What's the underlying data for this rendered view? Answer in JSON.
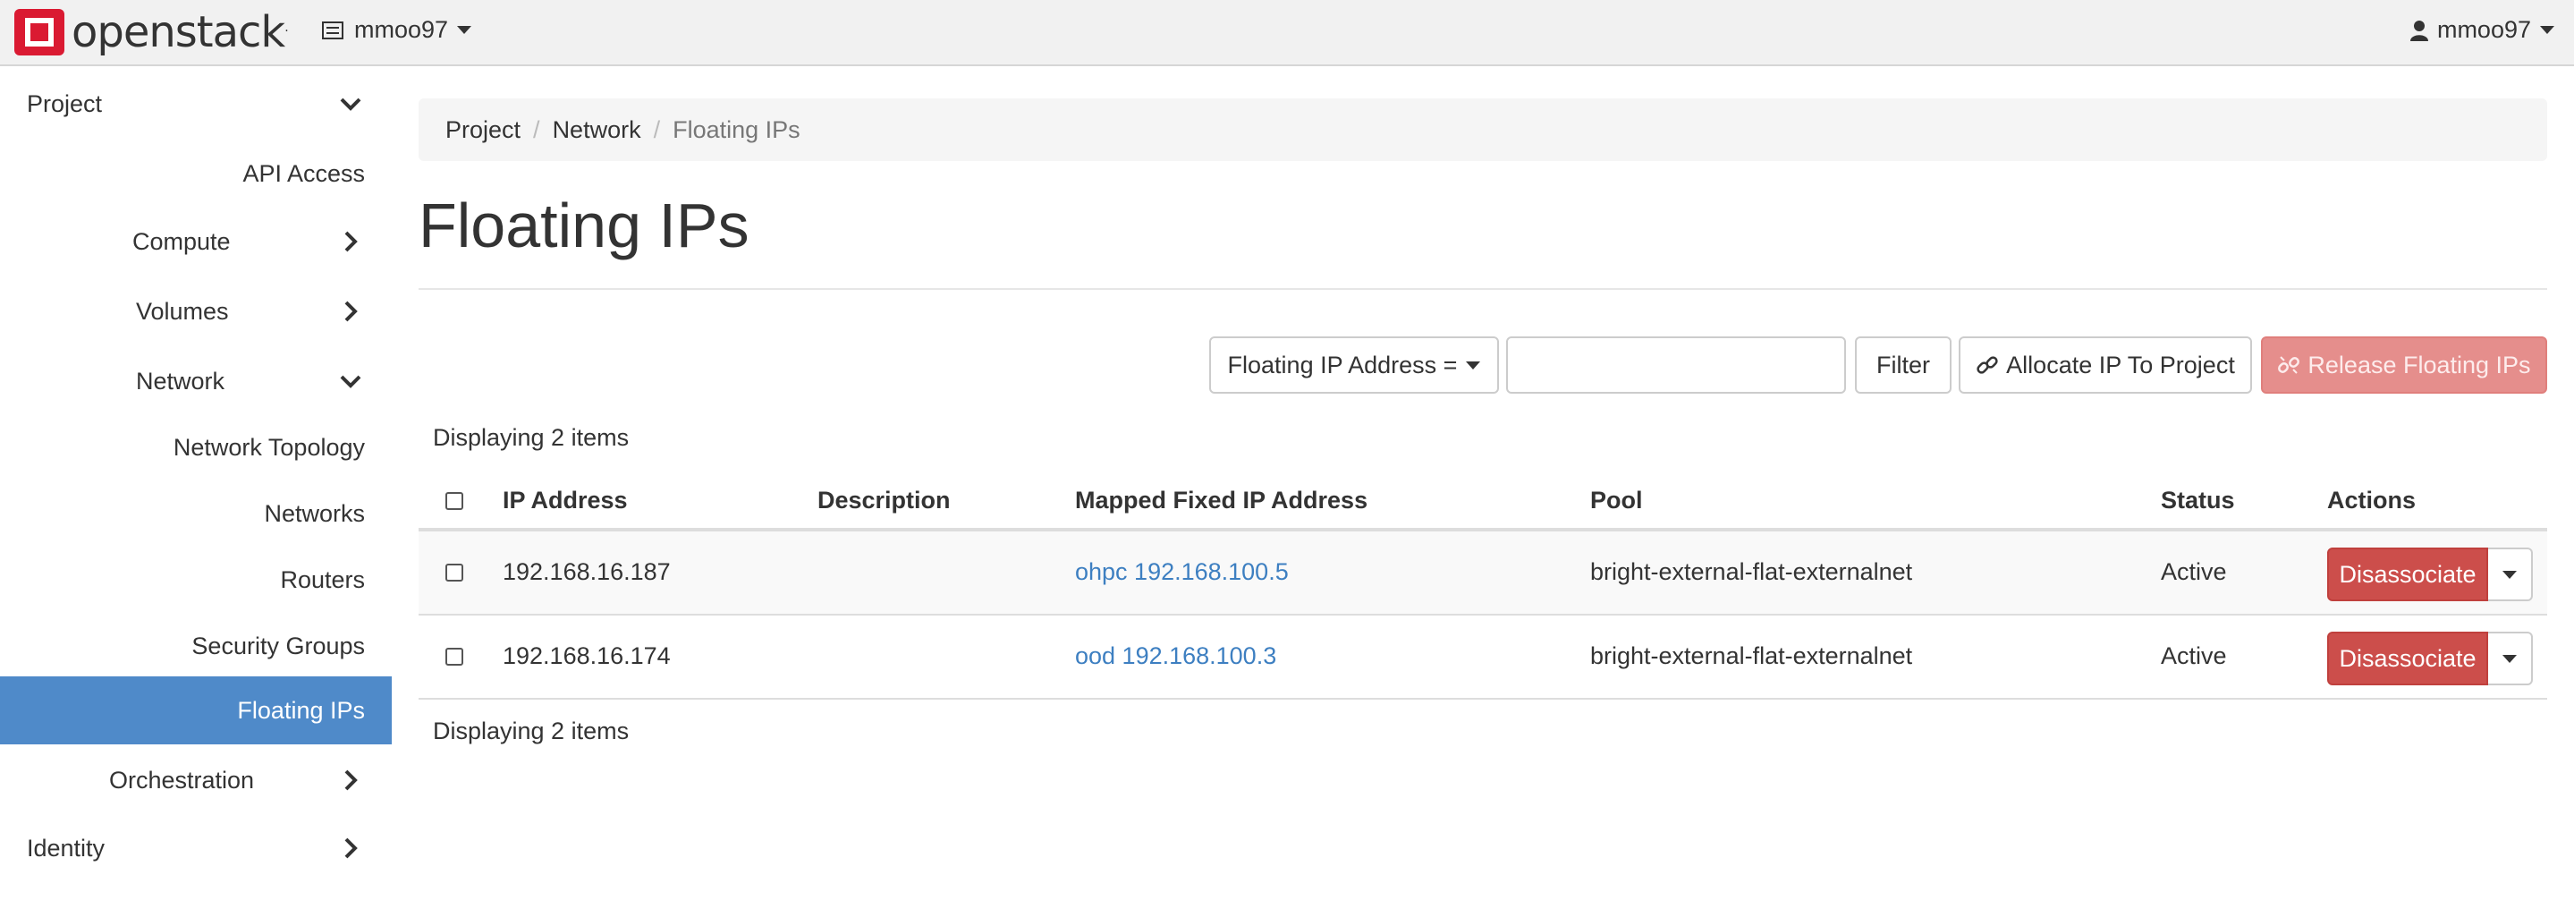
{
  "navbar": {
    "brand": "openstack",
    "brand_tm": ".",
    "project": "mmoo97",
    "user": "mmoo97"
  },
  "sidebar": {
    "items": [
      {
        "label": "Project",
        "chevron": "down"
      },
      {
        "label": "API Access",
        "chevron": "none"
      },
      {
        "label": "Compute",
        "chevron": "right"
      },
      {
        "label": "Volumes",
        "chevron": "right"
      },
      {
        "label": "Network",
        "chevron": "down"
      },
      {
        "label": "Network Topology",
        "chevron": "none"
      },
      {
        "label": "Networks",
        "chevron": "none"
      },
      {
        "label": "Routers",
        "chevron": "none"
      },
      {
        "label": "Security Groups",
        "chevron": "none"
      },
      {
        "label": "Floating IPs",
        "chevron": "none",
        "active": true
      },
      {
        "label": "Orchestration",
        "chevron": "right"
      },
      {
        "label": "Identity",
        "chevron": "right"
      }
    ]
  },
  "breadcrumb": {
    "items": [
      "Project",
      "Network",
      "Floating IPs"
    ],
    "separator": "/"
  },
  "page_title": "Floating IPs",
  "toolbar": {
    "filter_select": "Floating IP Address =",
    "filter_input_value": "",
    "filter_button": "Filter",
    "allocate_button": "Allocate IP To Project",
    "release_button": "Release Floating IPs"
  },
  "table": {
    "display_count_top": "Displaying 2 items",
    "display_count_bottom": "Displaying 2 items",
    "columns": [
      "IP Address",
      "Description",
      "Mapped Fixed IP Address",
      "Pool",
      "Status",
      "Actions"
    ],
    "rows": [
      {
        "ip": "192.168.16.187",
        "description": "",
        "mapped": "ohpc 192.168.100.5",
        "pool": "bright-external-flat-externalnet",
        "status": "Active",
        "action": "Disassociate"
      },
      {
        "ip": "192.168.16.174",
        "description": "",
        "mapped": "ood 192.168.100.3",
        "pool": "bright-external-flat-externalnet",
        "status": "Active",
        "action": "Disassociate"
      }
    ]
  },
  "colors": {
    "brand_red": "#da1a32",
    "active_nav": "#4f8ac9",
    "danger": "#cc4e4b",
    "link": "#3d7fc1"
  }
}
